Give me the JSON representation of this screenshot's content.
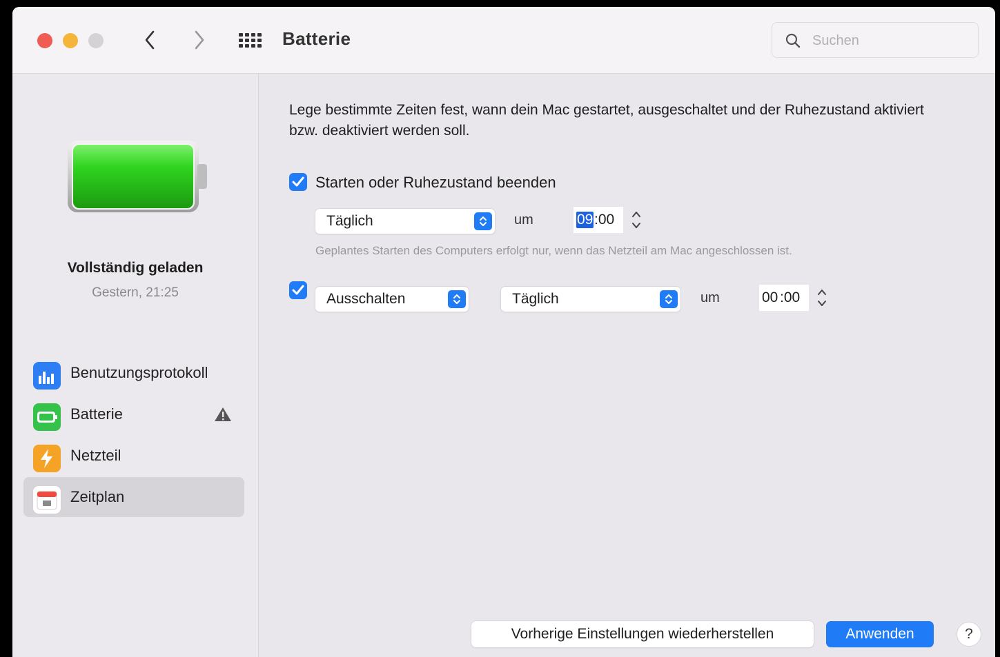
{
  "window": {
    "title": "Batterie"
  },
  "search": {
    "placeholder": "Suchen"
  },
  "sidebar": {
    "battery_status": "Vollständig geladen",
    "battery_time": "Gestern, 21:25",
    "battery_level": 1.0,
    "items": [
      {
        "label": "Benutzungsprotokoll",
        "icon": "bar-chart-icon",
        "color": "#2c7ef5"
      },
      {
        "label": "Batterie",
        "icon": "battery-icon",
        "color": "#35c24a",
        "warning": true
      },
      {
        "label": "Netzteil",
        "icon": "lightning-icon",
        "color": "#f4a326"
      },
      {
        "label": "Zeitplan",
        "icon": "calendar-icon",
        "color": "#ffffff",
        "active": true
      }
    ]
  },
  "main": {
    "description": "Lege bestimmte Zeiten fest, wann dein Mac gestartet, ausgeschaltet und der Ruhezustand aktiviert bzw. deaktiviert werden soll.",
    "start": {
      "checked": true,
      "label": "Starten oder Ruhezustand beenden",
      "frequency": "Täglich",
      "at_label": "um",
      "time_hours": "09",
      "time_rest": ":00",
      "note": "Geplantes Starten des Computers erfolgt nur, wenn das Netzteil am Mac angeschlossen ist."
    },
    "shutdown": {
      "checked": true,
      "action": "Ausschalten",
      "frequency": "Täglich",
      "at_label": "um",
      "time_hours": "00",
      "time_rest": ":00"
    },
    "buttons": {
      "restore": "Vorherige Einstellungen wiederherstellen",
      "apply": "Anwenden",
      "help": "?"
    }
  },
  "colors": {
    "accent": "#1f7cf6",
    "battery_green": "#2fd41f"
  }
}
